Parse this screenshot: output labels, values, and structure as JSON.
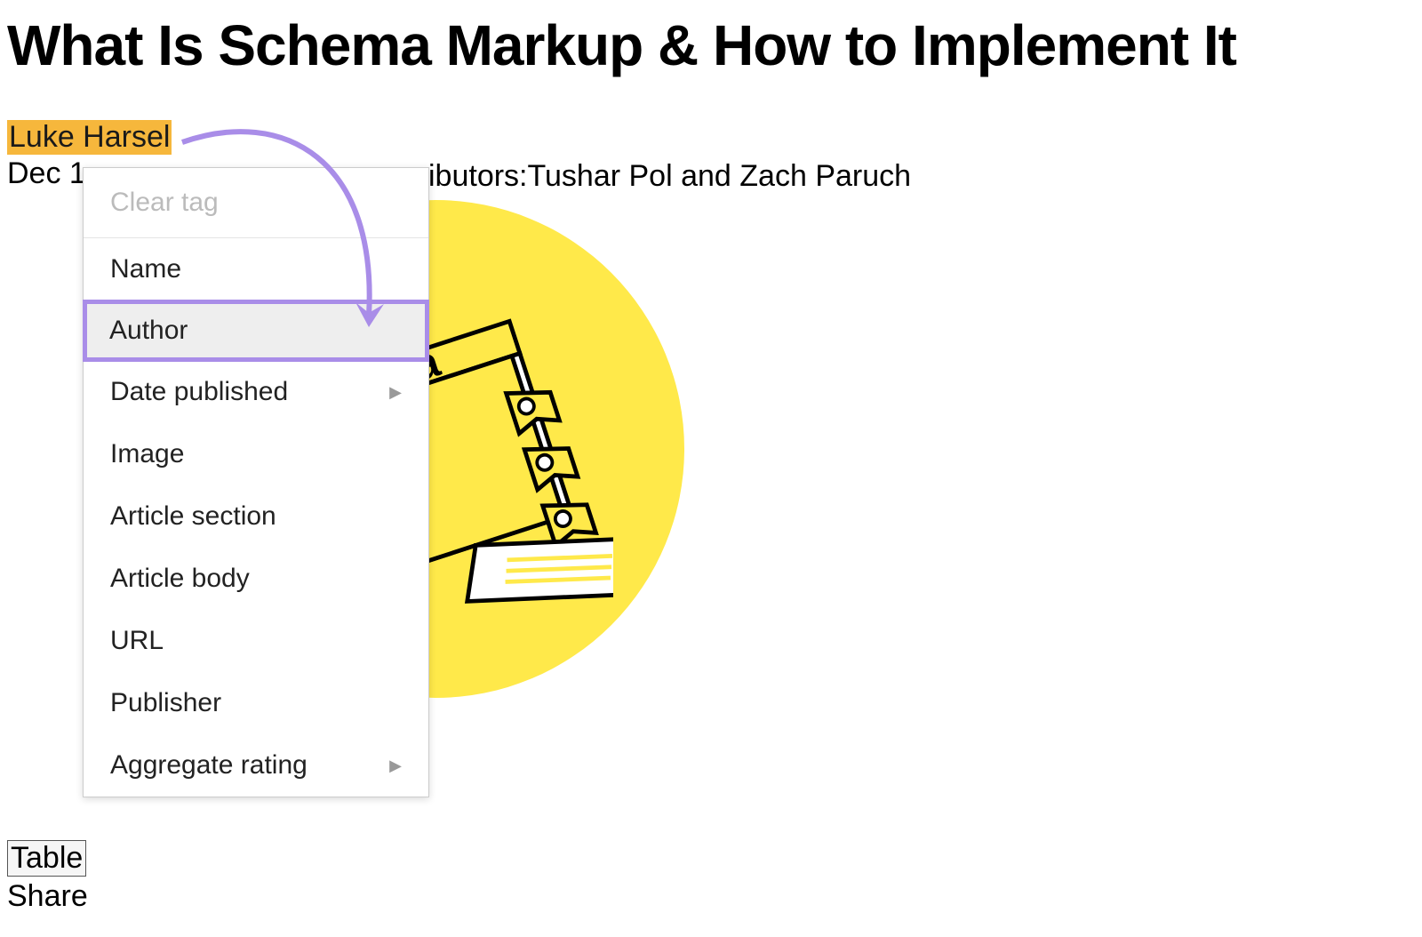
{
  "page": {
    "title": "What Is Schema Markup & How to Implement It"
  },
  "meta": {
    "author": "Luke Harsel",
    "date_partial": "Dec 1",
    "contributors_label": "ibutors:",
    "contributor1": "Tushar Pol",
    "and": " and ",
    "contributor2": "Zach Paruch"
  },
  "dropdown": {
    "clear": "Clear tag",
    "items": [
      {
        "label": "Name",
        "submenu": false
      },
      {
        "label": "Author",
        "submenu": false,
        "highlighted": true
      },
      {
        "label": "Date published",
        "submenu": true
      },
      {
        "label": "Image",
        "submenu": false
      },
      {
        "label": "Article section",
        "submenu": false
      },
      {
        "label": "Article body",
        "submenu": false
      },
      {
        "label": "URL",
        "submenu": false
      },
      {
        "label": "Publisher",
        "submenu": false
      },
      {
        "label": "Aggregate rating",
        "submenu": true
      }
    ]
  },
  "bottom": {
    "table": "Table",
    "share": "Share"
  },
  "illustration": {
    "book_text": "ma"
  }
}
